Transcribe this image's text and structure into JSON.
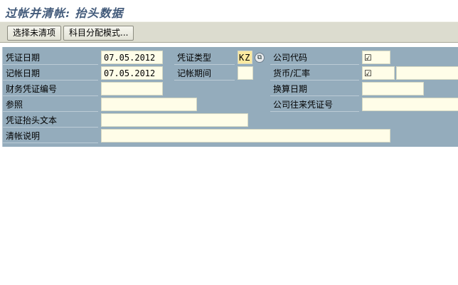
{
  "title": "过帐并清帐: 抬头数据",
  "toolbar": {
    "select_open_items": "选择未清项",
    "account_assignment_model": "科目分配模式..."
  },
  "form": {
    "doc_date_label": "凭证日期",
    "doc_date_value": "07.05.2012",
    "posting_date_label": "记帐日期",
    "posting_date_value": "07.05.2012",
    "fin_doc_no_label": "财务凭证编号",
    "fin_doc_no_value": "",
    "reference_label": "参照",
    "reference_value": "",
    "header_text_label": "凭证抬头文本",
    "header_text_value": "",
    "clearing_text_label": "清帐说明",
    "clearing_text_value": "",
    "doc_type_label": "凭证类型",
    "doc_type_value": "KZ",
    "period_label": "记帐期间",
    "period_value": "",
    "company_code_label": "公司代码",
    "company_code_value": "☑",
    "currency_label": "货币/汇率",
    "currency_value": "☑",
    "exchange_rate_value": "",
    "translation_date_label": "换算日期",
    "translation_date_value": "",
    "intercompany_no_label": "公司往来凭证号",
    "intercompany_no_value": ""
  },
  "icons": {
    "matchcode": "search-help-icon",
    "checkbox": "checkbox-icon"
  },
  "colors": {
    "panel_bg": "#94acbc",
    "field_bg": "#fffde8",
    "highlight_bg": "#fbe9a0",
    "toolbar_bg": "#dcdccf",
    "title_color": "#425a7a"
  }
}
